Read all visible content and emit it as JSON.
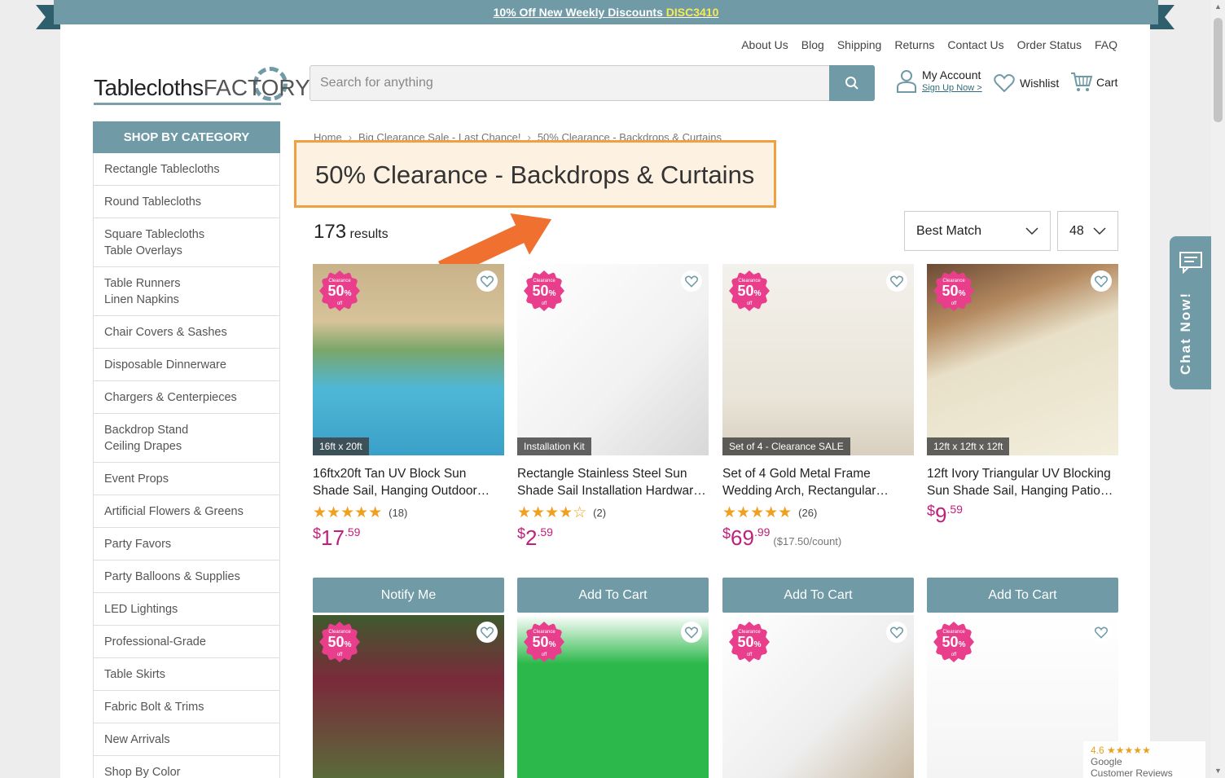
{
  "promo": {
    "text": "10% Off New Weekly Discounts ",
    "code": "DISC3410"
  },
  "top_links": [
    "About Us",
    "Blog",
    "Shipping",
    "Returns",
    "Contact Us",
    "Order Status",
    "FAQ"
  ],
  "logo": {
    "part1": "Tablecloths",
    "part2": "FACTORY"
  },
  "search": {
    "placeholder": "Search for anything"
  },
  "account": {
    "label": "My Account",
    "sub": "Sign Up Now >"
  },
  "wishlist": {
    "label": "Wishlist"
  },
  "cart": {
    "label": "Cart"
  },
  "sidebar": {
    "header": "SHOP BY CATEGORY",
    "items": [
      "Rectangle Tablecloths",
      "Round Tablecloths",
      "Square Tablecloths\nTable Overlays",
      "Table Runners\nLinen Napkins",
      "Chair Covers & Sashes",
      "Disposable Dinnerware",
      "Chargers & Centerpieces",
      "Backdrop Stand\nCeiling Drapes",
      "Event Props",
      "Artificial Flowers & Greens",
      "Party Favors",
      "Party Balloons & Supplies",
      "LED Lightings",
      "Professional-Grade",
      "Table Skirts",
      "Fabric Bolt & Trims",
      "New Arrivals",
      "Shop By Color"
    ]
  },
  "breadcrumb": [
    "Home",
    "Big Clearance Sale - Last Chance!",
    "50% Clearance - Backdrops & Curtains"
  ],
  "page_title": "50% Clearance - Backdrops & Curtains",
  "results": {
    "count": "173",
    "label": "results"
  },
  "sort": {
    "selected": "Best Match"
  },
  "per_page": {
    "selected": "48"
  },
  "badge": {
    "top": "Clearance",
    "value": "50",
    "pct": "%",
    "off": "off"
  },
  "products": [
    {
      "tag": "16ft x 20ft",
      "name": "16ftx20ft Tan UV Block Sun Shade Sail, Hanging Outdoor…",
      "stars": "★★★★★",
      "reviews": "(18)",
      "price_whole": "17",
      "price_cents": "59",
      "unit": "",
      "button": "Notify Me"
    },
    {
      "tag": "Installation Kit",
      "name": "Rectangle Stainless Steel Sun Shade Sail Installation Hardwar…",
      "stars": "★★★★☆",
      "reviews": "(2)",
      "price_whole": "2",
      "price_cents": "59",
      "unit": "",
      "button": "Add To Cart"
    },
    {
      "tag": "Set of 4 - Clearance SALE",
      "name": "Set of 4 Gold Metal Frame Wedding Arch, Rectangular…",
      "stars": "★★★★★",
      "reviews": "(26)",
      "price_whole": "69",
      "price_cents": "99",
      "unit": "($17.50/count)",
      "button": "Add To Cart"
    },
    {
      "tag": "12ft x 12ft x 12ft",
      "name": "12ft Ivory Triangular UV Blocking Sun Shade Sail, Hanging Patio…",
      "stars": "",
      "reviews": "",
      "price_whole": "9",
      "price_cents": "59",
      "unit": "",
      "button": "Add To Cart"
    }
  ],
  "chat": {
    "label": "Chat Now!"
  },
  "google": {
    "score": "4.6",
    "stars": "★★★★★",
    "line1": "Google",
    "line2": "Customer Reviews"
  },
  "colors": {
    "brand": "#6f9aa6",
    "accent_pink": "#c0207a",
    "title_box_border": "#f0a040"
  }
}
